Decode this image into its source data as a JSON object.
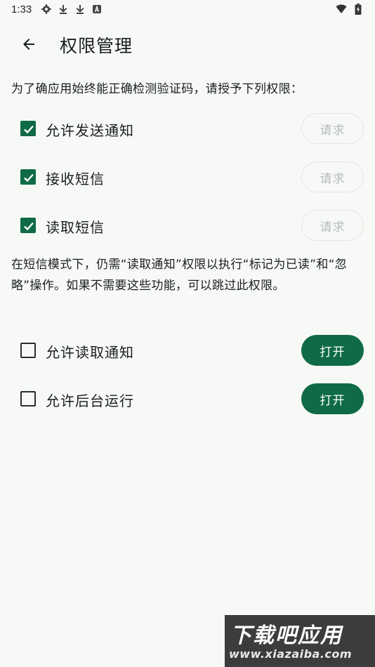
{
  "status_bar": {
    "time": "1:33",
    "left_icons": [
      "gear-icon",
      "download-icon",
      "download-icon",
      "a-icon"
    ],
    "right_icons": [
      "wifi-icon",
      "battery-charging-icon"
    ]
  },
  "app_bar": {
    "title": "权限管理",
    "back_icon": "arrow-left-icon"
  },
  "intro_text": "为了确应用始终能正确检测验证码，请授予下列权限：",
  "sms_permissions": [
    {
      "label": "允许发送通知",
      "checked": true,
      "button_label": "请求",
      "button_enabled": false
    },
    {
      "label": "接收短信",
      "checked": true,
      "button_label": "请求",
      "button_enabled": false
    },
    {
      "label": "读取短信",
      "checked": true,
      "button_label": "请求",
      "button_enabled": false
    }
  ],
  "note_text": "在短信模式下，仍需“读取通知”权限以执行“标记为已读”和“忽略”操作。如果不需要这些功能，可以跳过此权限。",
  "optional_permissions": [
    {
      "label": "允许读取通知",
      "checked": false,
      "button_label": "打开",
      "button_enabled": true
    },
    {
      "label": "允许后台运行",
      "checked": false,
      "button_label": "打开",
      "button_enabled": true
    }
  ],
  "watermark": {
    "title": "下载吧应用",
    "url": "www.xiazaiba.com"
  },
  "colors": {
    "background": "#f7f9f6",
    "accent": "#0e6b45",
    "disabled_text": "#b8bcb8",
    "text": "#1b1f1c"
  }
}
